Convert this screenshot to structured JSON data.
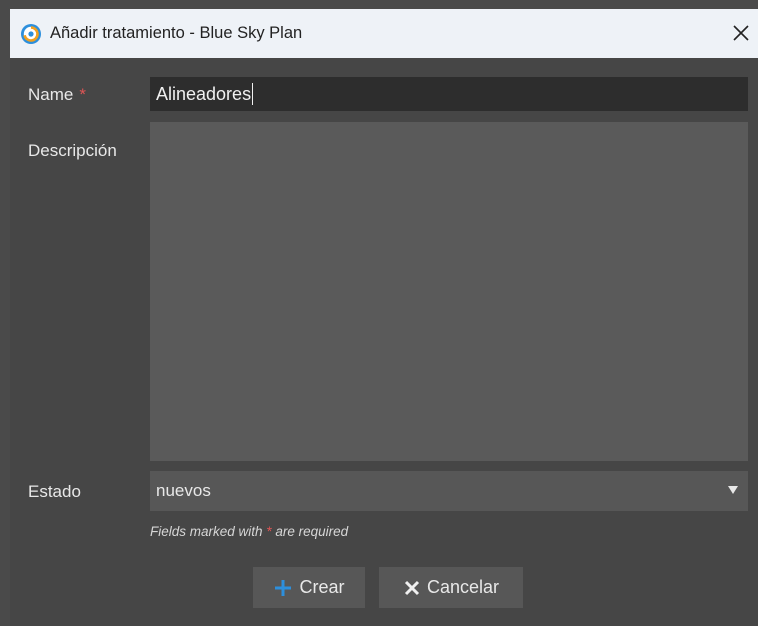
{
  "window": {
    "title": "Añadir tratamiento - Blue Sky Plan",
    "app_icon": "blue-sky-plan-icon",
    "close_icon": "close-icon"
  },
  "form": {
    "name_label": "Name",
    "required_mark": "*",
    "name_value": "Alineadores",
    "description_label": "Descripción",
    "description_value": "",
    "status_label": "Estado",
    "status_value": "nuevos",
    "note_prefix": "Fields marked with ",
    "note_suffix": " are required"
  },
  "buttons": {
    "create_label": "Crear",
    "cancel_label": "Cancelar"
  },
  "colors": {
    "accent": "#2d8fdc",
    "required": "#e05555",
    "titlebar": "#eef2f7",
    "dialog_bg": "#464646"
  }
}
